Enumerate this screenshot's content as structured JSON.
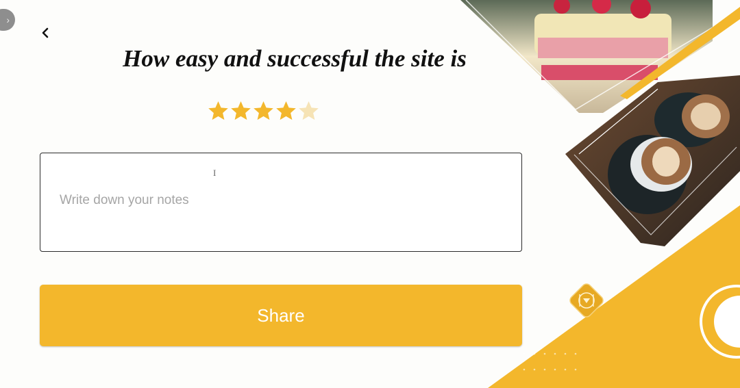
{
  "header": {
    "title": "How easy and successful the site is",
    "back_icon": "chevron-left-icon",
    "side_toggle_icon": "chevron-right-icon"
  },
  "rating": {
    "value": 4,
    "max": 5,
    "filled_color": "#f3b72c",
    "empty_color": "#f6e3b5"
  },
  "notes": {
    "placeholder": "Write down your notes",
    "value": ""
  },
  "share": {
    "label": "Share"
  },
  "theme": {
    "accent": "#f3b72c",
    "badge_icon": "dish-icon"
  }
}
